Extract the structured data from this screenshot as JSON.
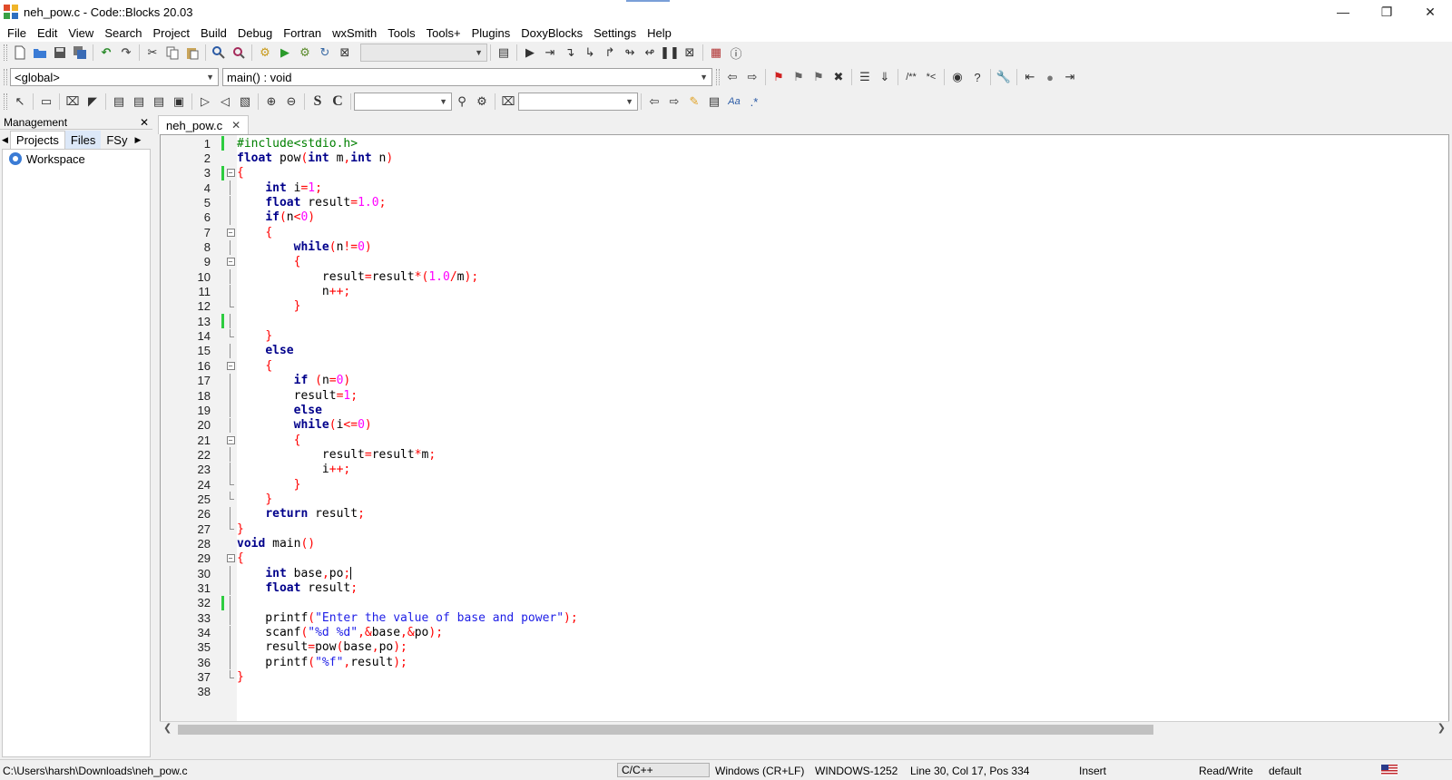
{
  "window": {
    "title": "neh_pow.c - Code::Blocks 20.03"
  },
  "menu": [
    "File",
    "Edit",
    "View",
    "Search",
    "Project",
    "Build",
    "Debug",
    "Fortran",
    "wxSmith",
    "Tools",
    "Tools+",
    "Plugins",
    "DoxyBlocks",
    "Settings",
    "Help"
  ],
  "toolbar": {
    "scope_value": "<global>",
    "function_value": "main() : void"
  },
  "management": {
    "title": "Management",
    "tabs": [
      "Projects",
      "Files",
      "FSy"
    ],
    "workspace_label": "Workspace"
  },
  "editor": {
    "tab_label": "neh_pow.c",
    "lines": [
      {
        "n": "1"
      },
      {
        "n": "2"
      },
      {
        "n": "3"
      },
      {
        "n": "4"
      },
      {
        "n": "5"
      },
      {
        "n": "6"
      },
      {
        "n": "7"
      },
      {
        "n": "8"
      },
      {
        "n": "9"
      },
      {
        "n": "10"
      },
      {
        "n": "11"
      },
      {
        "n": "12"
      },
      {
        "n": "13"
      },
      {
        "n": "14"
      },
      {
        "n": "15"
      },
      {
        "n": "16"
      },
      {
        "n": "17"
      },
      {
        "n": "18"
      },
      {
        "n": "19"
      },
      {
        "n": "20"
      },
      {
        "n": "21"
      },
      {
        "n": "22"
      },
      {
        "n": "23"
      },
      {
        "n": "24"
      },
      {
        "n": "25"
      },
      {
        "n": "26"
      },
      {
        "n": "27"
      },
      {
        "n": "28"
      },
      {
        "n": "29"
      },
      {
        "n": "30"
      },
      {
        "n": "31"
      },
      {
        "n": "32"
      },
      {
        "n": "33"
      },
      {
        "n": "34"
      },
      {
        "n": "35"
      },
      {
        "n": "36"
      },
      {
        "n": "37"
      },
      {
        "n": "38"
      }
    ],
    "code": [
      "#include<stdio.h>",
      "float pow(int m,int n)",
      "{",
      "    int i=1;",
      "    float result=1.0;",
      "    if(n<0)",
      "    {",
      "        while(n!=0)",
      "        {",
      "            result=result*(1.0/m);",
      "            n++;",
      "        }",
      "",
      "    }",
      "    else",
      "    {",
      "        if (n=0)",
      "        result=1;",
      "        else",
      "        while(i<=0)",
      "        {",
      "            result=result*m;",
      "            i++;",
      "        }",
      "    }",
      "    return result;",
      "}",
      "void main()",
      "{",
      "    int base,po;",
      "    float result;",
      "",
      "    printf(\"Enter the value of base and power\");",
      "    scanf(\"%d %d\",&base,&po);",
      "    result=pow(base,po);",
      "    printf(\"%f\",result);",
      "}",
      ""
    ]
  },
  "status": {
    "path": "C:\\Users\\harsh\\Downloads\\neh_pow.c",
    "language": "C/C++",
    "line_endings": "Windows (CR+LF)",
    "encoding": "WINDOWS-1252",
    "position": "Line 30, Col 17, Pos 334",
    "mode": "Insert",
    "access": "Read/Write",
    "profile": "default"
  }
}
